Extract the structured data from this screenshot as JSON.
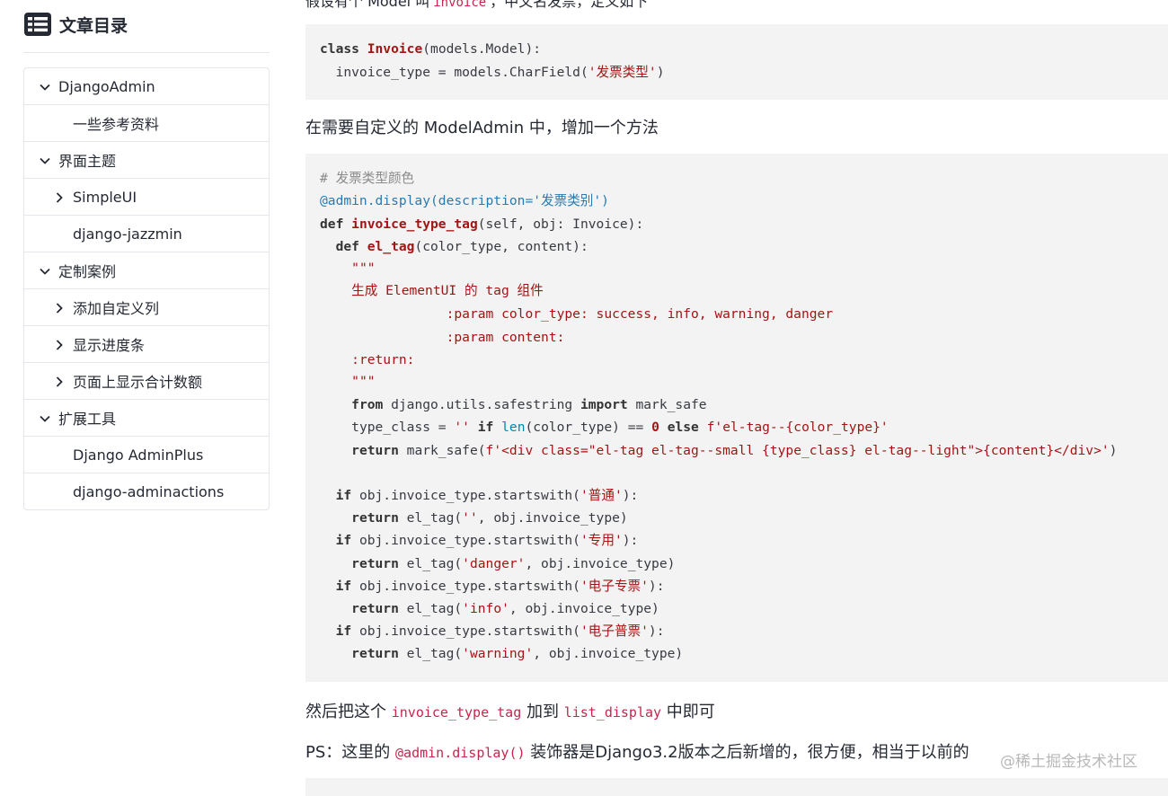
{
  "toc": {
    "title": "文章目录",
    "items": [
      {
        "label": "DjangoAdmin",
        "level": 1,
        "arrow": "down"
      },
      {
        "label": "一些参考资料",
        "level": 2,
        "arrow": "none"
      },
      {
        "label": "界面主题",
        "level": 1,
        "arrow": "down"
      },
      {
        "label": "SimpleUI",
        "level": 2,
        "arrow": "right"
      },
      {
        "label": "django-jazzmin",
        "level": 2,
        "arrow": "none"
      },
      {
        "label": "定制案例",
        "level": 1,
        "arrow": "down"
      },
      {
        "label": "添加自定义列",
        "level": 2,
        "arrow": "right"
      },
      {
        "label": "显示进度条",
        "level": 2,
        "arrow": "right"
      },
      {
        "label": "页面上显示合计数额",
        "level": 2,
        "arrow": "right"
      },
      {
        "label": "扩展工具",
        "level": 1,
        "arrow": "down"
      },
      {
        "label": "Django AdminPlus",
        "level": 2,
        "arrow": "none"
      },
      {
        "label": "django-adminactions",
        "level": 2,
        "arrow": "none"
      }
    ]
  },
  "article": {
    "top_text_1": "假设有个 Model 叫",
    "top_code": "invoice",
    "top_text_2": "，中文名发票，定义如下",
    "code1": {
      "l1_kw": "class",
      "l1_name": "Invoice",
      "l1_rest": "(models.Model):",
      "l2_pre": "  invoice_type = models.CharField(",
      "l2_str": "'发票类型'",
      "l2_post": ")"
    },
    "para1": "在需要自定义的 ModelAdmin 中，增加一个方法",
    "code2": {
      "c1": "# 发票类型颜色",
      "c2": "@admin.display(description='发票类别')",
      "c3_kw": "def",
      "c3_fn": "invoice_type_tag",
      "c3_rest": "(self, obj: Invoice):",
      "c4_kw": "def",
      "c4_fn": "el_tag",
      "c4_rest": "(color_type, content):",
      "c5": "\"\"\"",
      "c6": "生成 ElementUI 的 tag 组件",
      "c7": ":param color_type: success, info, warning, danger",
      "c8": ":param content:",
      "c9": ":return:",
      "c10": "\"\"\"",
      "c11_kw1": "from",
      "c11_mid": " django.utils.safestring ",
      "c11_kw2": "import",
      "c11_end": " mark_safe",
      "c12_pre": "type_class = ",
      "c12_str1": "''",
      "c12_kw1": "if",
      "c12_bi": "len",
      "c12_mid": "(color_type) == ",
      "c12_num": "0",
      "c12_kw2": "else",
      "c12_str2": "f'el-tag--{color_type}'",
      "c13_kw": "return",
      "c13_mid": " mark_safe(",
      "c13_str": "f'<div class=\"el-tag el-tag--small {type_class} el-tag--light\">{content}</div>'",
      "c13_end": ")",
      "c14_kw": "if",
      "c14_mid": " obj.invoice_type.startswith(",
      "c14_str": "'普通'",
      "c14_end": "):",
      "c15_kw": "return",
      "c15_mid": " el_tag(",
      "c15_str": "''",
      "c15_end": ", obj.invoice_type)",
      "c16_kw": "if",
      "c16_mid": " obj.invoice_type.startswith(",
      "c16_str": "'专用'",
      "c16_end": "):",
      "c17_kw": "return",
      "c17_mid": " el_tag(",
      "c17_str": "'danger'",
      "c17_end": ", obj.invoice_type)",
      "c18_kw": "if",
      "c18_mid": " obj.invoice_type.startswith(",
      "c18_str": "'电子专票'",
      "c18_end": "):",
      "c19_kw": "return",
      "c19_mid": " el_tag(",
      "c19_str": "'info'",
      "c19_end": ", obj.invoice_type)",
      "c20_kw": "if",
      "c20_mid": " obj.invoice_type.startswith(",
      "c20_str": "'电子普票'",
      "c20_end": "):",
      "c21_kw": "return",
      "c21_mid": " el_tag(",
      "c21_str": "'warning'",
      "c21_end": ", obj.invoice_type)"
    },
    "para2_a": "然后把这个 ",
    "para2_code1": "invoice_type_tag",
    "para2_b": " 加到 ",
    "para2_code2": "list_display",
    "para2_c": " 中即可",
    "para3_a": "PS：这里的 ",
    "para3_code": "@admin.display()",
    "para3_b": " 装饰器是Django3.2版本之后新增的，很方便，相当于以前的",
    "watermark": "@稀土掘金技术社区"
  }
}
